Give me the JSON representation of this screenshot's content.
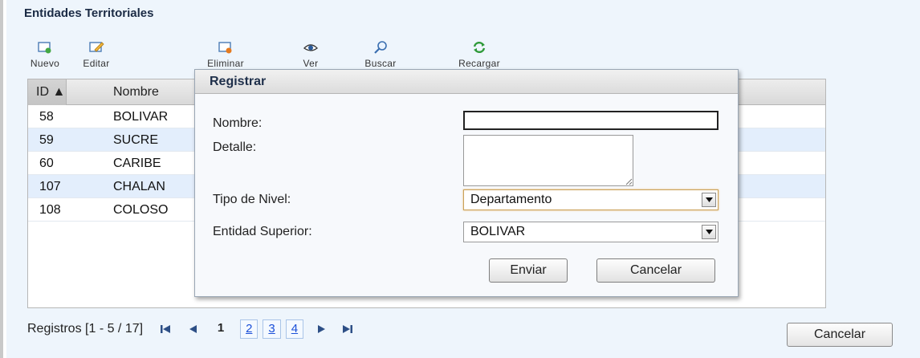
{
  "title": "Entidades Territoriales",
  "toolbar": {
    "nuevo": "Nuevo",
    "editar": "Editar",
    "eliminar": "Eliminar",
    "ver": "Ver",
    "buscar": "Buscar",
    "recargar": "Recargar"
  },
  "grid": {
    "columns": [
      "ID ▲",
      "Nombre"
    ],
    "rows": [
      {
        "id": "58",
        "nombre": "BOLIVAR"
      },
      {
        "id": "59",
        "nombre": "SUCRE"
      },
      {
        "id": "60",
        "nombre": "CARIBE"
      },
      {
        "id": "107",
        "nombre": "CHALAN"
      },
      {
        "id": "108",
        "nombre": "COLOSO"
      }
    ]
  },
  "pager": {
    "label": "Registros [1 - 5 / 17]",
    "current": "1",
    "pages": [
      "2",
      "3",
      "4"
    ]
  },
  "cancel_label": "Cancelar",
  "dialog": {
    "title": "Registrar",
    "nombre_label": "Nombre:",
    "nombre_value": "",
    "detalle_label": "Detalle:",
    "detalle_value": "",
    "tipo_label": "Tipo de Nivel:",
    "tipo_value": "Departamento",
    "entidad_label": "Entidad Superior:",
    "entidad_value": "BOLIVAR",
    "enviar": "Enviar",
    "cancelar": "Cancelar"
  }
}
